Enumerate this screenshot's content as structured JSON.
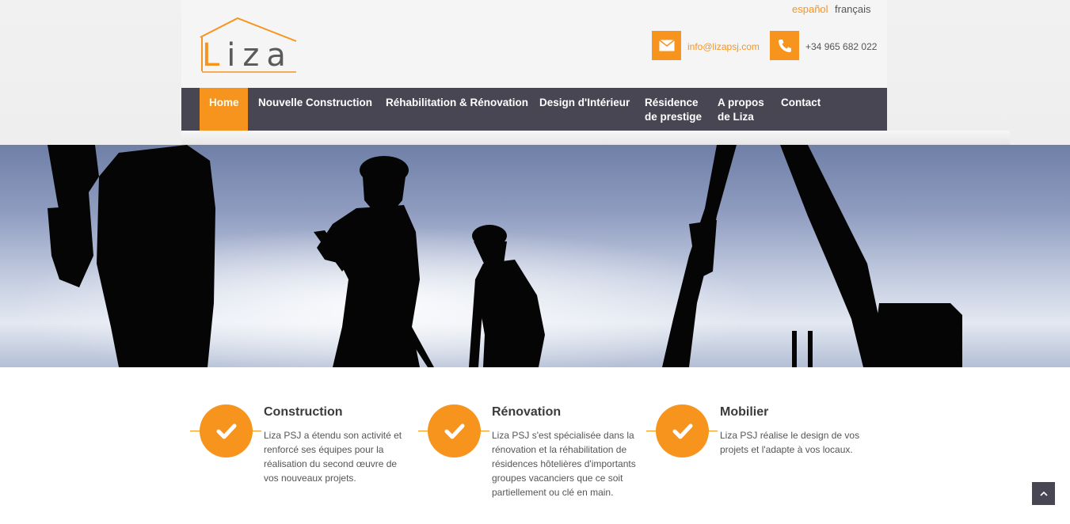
{
  "header": {
    "logo_text": "Liza",
    "logo_first_letter": "L",
    "logo_rest": "iza",
    "languages": [
      "español",
      "français"
    ],
    "email": "info@lizapsj.com",
    "phone": "+34 965 682 022",
    "icons": [
      "envelope-icon",
      "phone-icon"
    ]
  },
  "nav": {
    "items": [
      {
        "label": "Home",
        "active": true
      },
      {
        "label": "Nouvelle Construction",
        "active": false
      },
      {
        "label": "Réhabilitation & Rénovation",
        "active": false
      },
      {
        "label": "Design d'Intérieur",
        "active": false
      },
      {
        "label_line1": "Résidence",
        "label_line2": "de prestige",
        "active": false
      },
      {
        "label_line1": "A propos",
        "label_line2": "de Liza",
        "active": false
      },
      {
        "label": "Contact",
        "active": false
      }
    ]
  },
  "features": [
    {
      "title": "Construction",
      "lines": [
        "Liza PSJ a étendu son activité et",
        "renforcé ses équipes pour la",
        "réalisation du second œuvre de",
        "vos nouveaux projets."
      ],
      "icon": "check-icon"
    },
    {
      "title": "Rénovation",
      "lines": [
        "Liza PSJ s'est spécialisée dans la",
        "rénovation et la réhabilitation de",
        "résidences hôtelières d'importants",
        "groupes vacanciers que ce soit",
        "partiellement ou clé en main."
      ],
      "icon": "check-icon"
    },
    {
      "title": "Mobilier",
      "lines": [
        "Liza PSJ réalise le design de vos",
        "projets et l'adapte à vos locaux."
      ],
      "icon": "check-icon"
    }
  ],
  "colors": {
    "accent": "#f7941d",
    "nav_background": "#474652",
    "text": "#555555"
  },
  "hero": {
    "icon": "hero-construction-silhouettes"
  },
  "back_to_top": {
    "icon": "chevron-up-icon"
  }
}
